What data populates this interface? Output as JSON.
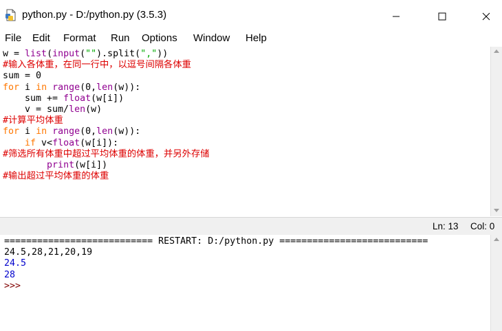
{
  "window": {
    "title": "python.py - D:/python.py (3.5.3)",
    "controls": {
      "minimize": "—",
      "maximize": "☐",
      "close": "✕"
    }
  },
  "menu": [
    "File",
    "Edit",
    "Format",
    "Run",
    "Options",
    "Window",
    "Help"
  ],
  "code_lines": [
    [
      [
        "df",
        "w = "
      ],
      [
        "bi",
        "list"
      ],
      [
        "df",
        "("
      ],
      [
        "bi",
        "input"
      ],
      [
        "df",
        "("
      ],
      [
        "str",
        "\"\""
      ],
      [
        "df",
        ")."
      ],
      [
        "df",
        "split("
      ],
      [
        "str",
        "\",\""
      ],
      [
        "df",
        "))"
      ]
    ],
    [
      [
        "cm",
        "#输入各体重，在同一行中，以逗号间隔各体重"
      ]
    ],
    [
      [
        "df",
        "sum = 0"
      ]
    ],
    [
      [
        "kw",
        "for"
      ],
      [
        "df",
        " i "
      ],
      [
        "kw",
        "in"
      ],
      [
        "df",
        " "
      ],
      [
        "bi",
        "range"
      ],
      [
        "df",
        "(0,"
      ],
      [
        "bi",
        "len"
      ],
      [
        "df",
        "(w)):"
      ]
    ],
    [
      [
        "df",
        "    sum += "
      ],
      [
        "bi",
        "float"
      ],
      [
        "df",
        "(w[i])"
      ]
    ],
    [
      [
        "df",
        "    v = sum/"
      ],
      [
        "bi",
        "len"
      ],
      [
        "df",
        "(w)"
      ]
    ],
    [
      [
        "cm",
        "#计算平均体重"
      ]
    ],
    [
      [
        "kw",
        "for"
      ],
      [
        "df",
        " i "
      ],
      [
        "kw",
        "in"
      ],
      [
        "df",
        " "
      ],
      [
        "bi",
        "range"
      ],
      [
        "df",
        "(0,"
      ],
      [
        "bi",
        "len"
      ],
      [
        "df",
        "(w)):"
      ]
    ],
    [
      [
        "df",
        "    "
      ],
      [
        "kw",
        "if"
      ],
      [
        "df",
        " v<"
      ],
      [
        "bi",
        "float"
      ],
      [
        "df",
        "(w[i]):"
      ]
    ],
    [
      [
        "cm",
        "#筛选所有体重中超过平均体重的体重，并另外存储"
      ]
    ],
    [
      [
        "df",
        "        "
      ],
      [
        "bi",
        "print"
      ],
      [
        "df",
        "(w[i])"
      ]
    ],
    [
      [
        "cm",
        "#输出超过平均体重的体重"
      ]
    ]
  ],
  "status": {
    "line": "Ln: 13",
    "col": "Col: 0"
  },
  "shell_lines": [
    [
      "restart",
      "=========================== RESTART: D:/python.py ==========================="
    ],
    [
      "in",
      "24.5,28,21,20,19"
    ],
    [
      "out",
      "24.5"
    ],
    [
      "out",
      "28"
    ],
    [
      "prompt",
      ">>>"
    ]
  ],
  "colors": {
    "keyword": "#ff7700",
    "builtin": "#900090",
    "string": "#00aa00",
    "comment": "#dd0000",
    "shell_output": "#0000cc"
  }
}
